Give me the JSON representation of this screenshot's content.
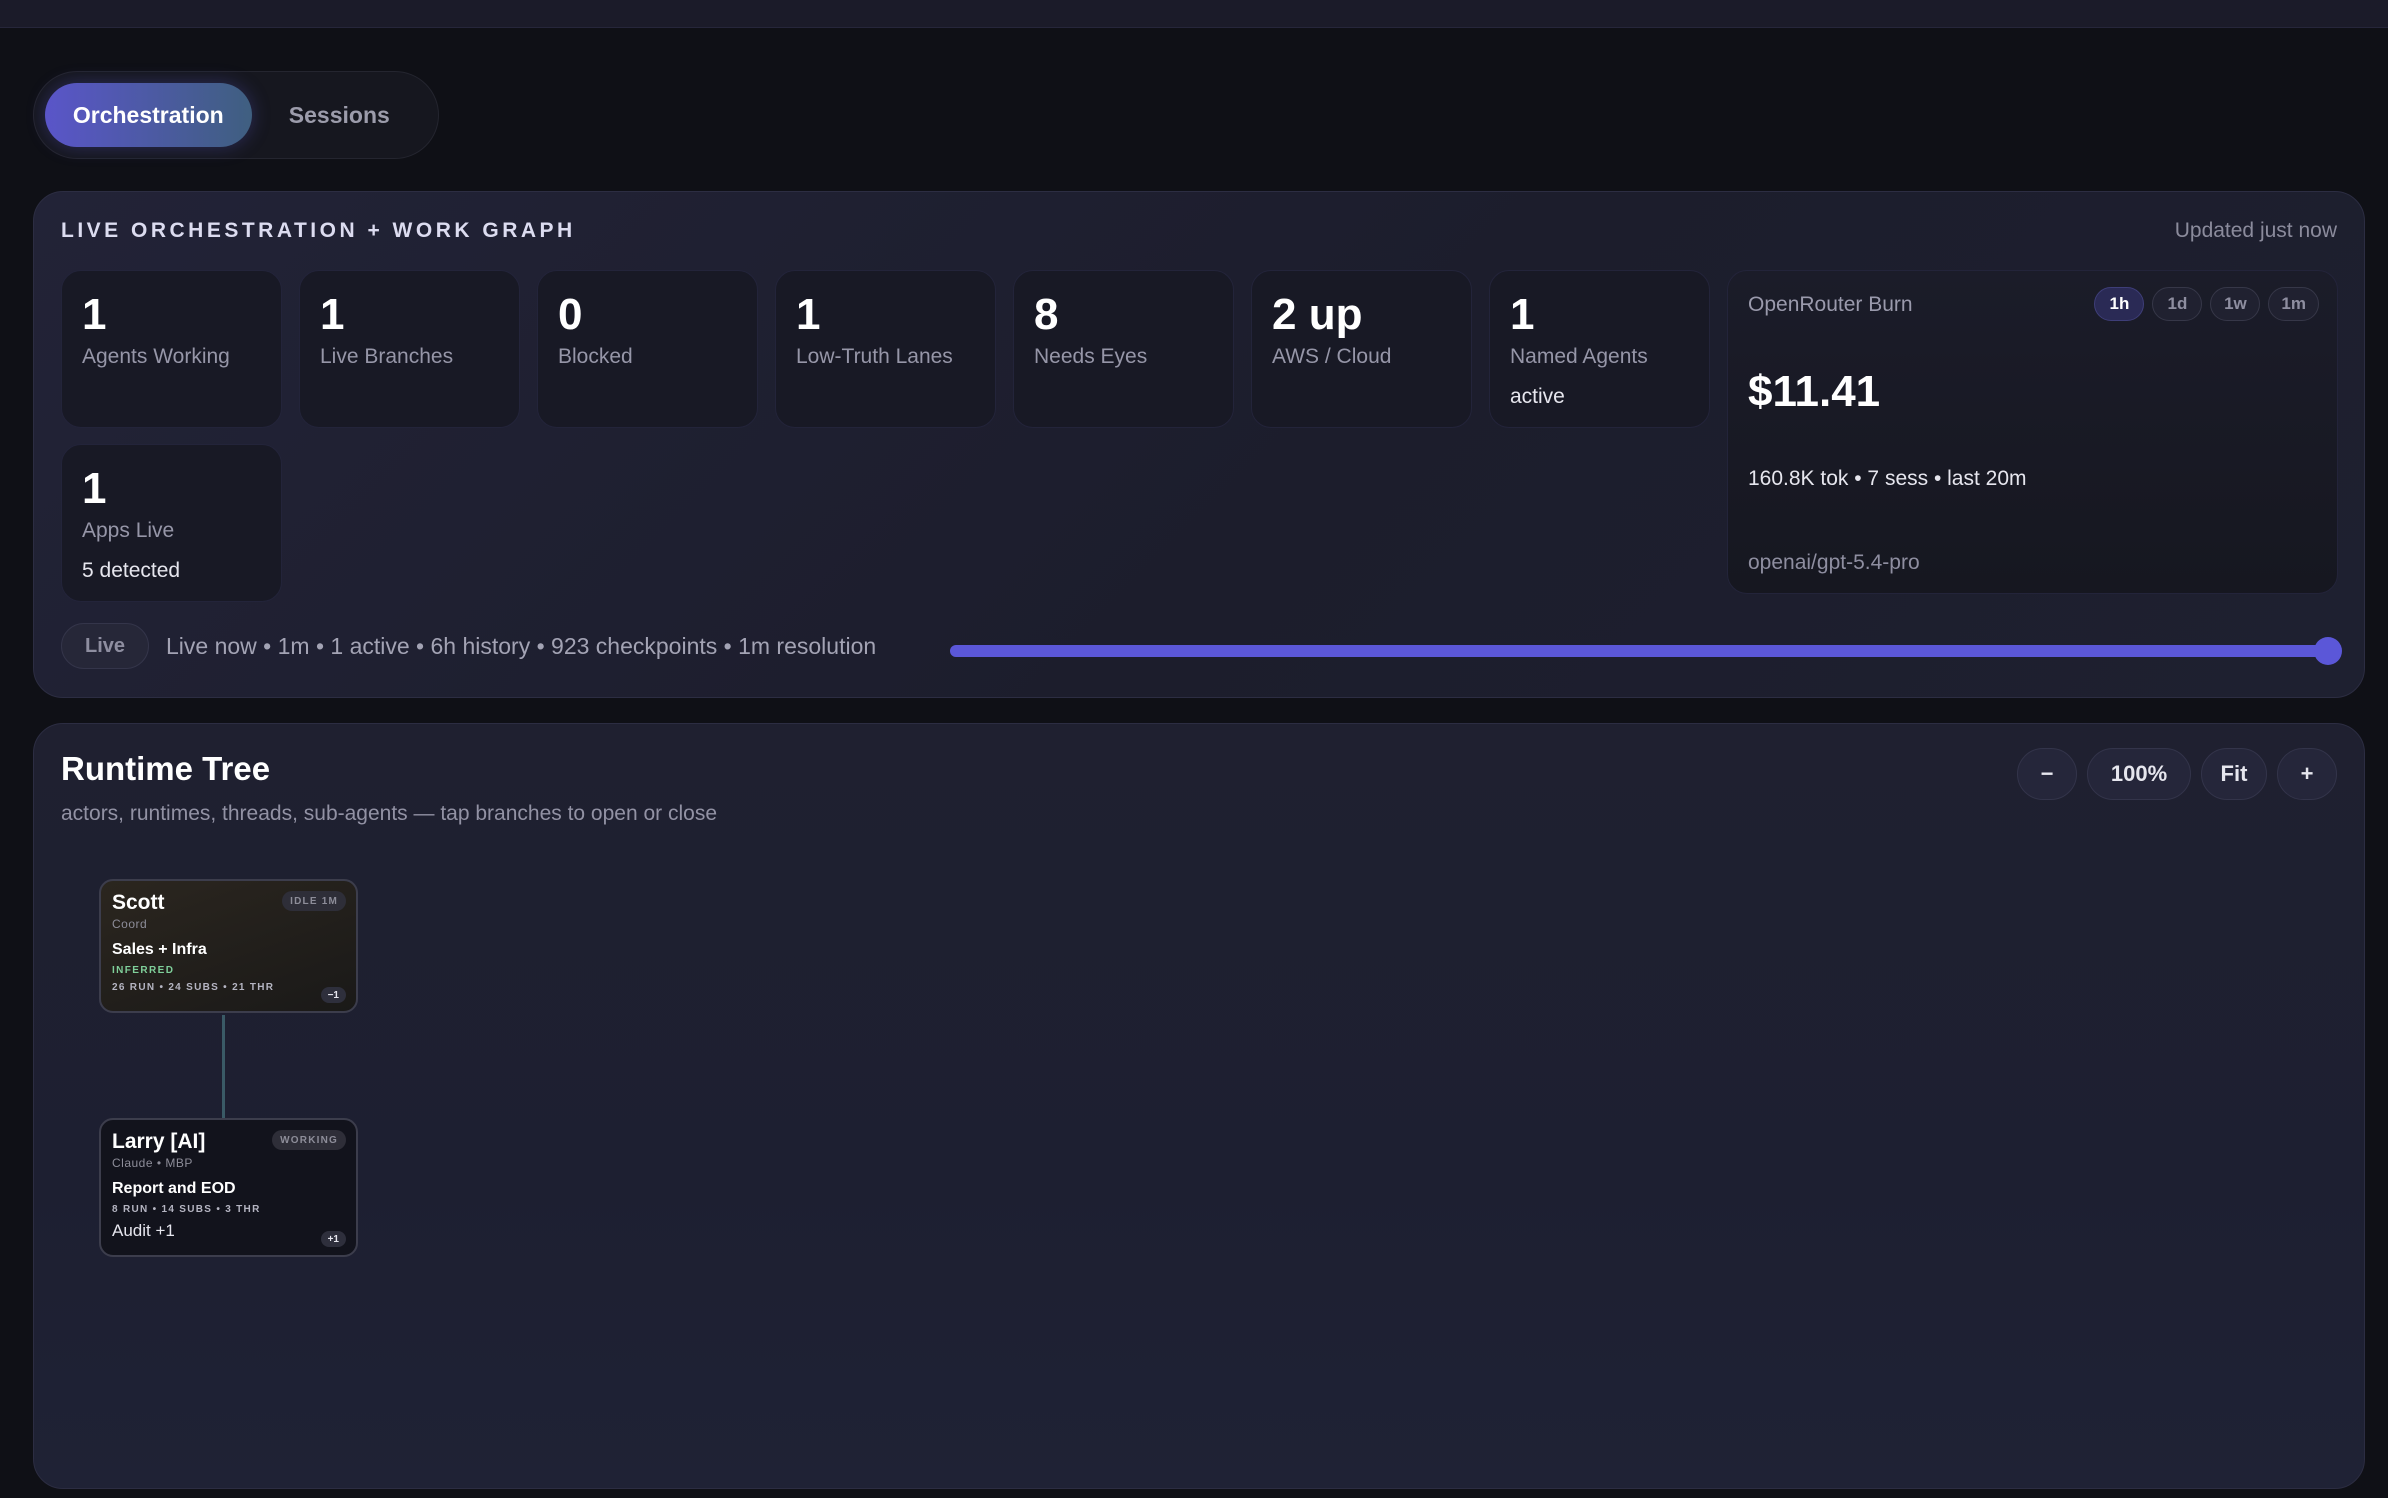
{
  "tabs": [
    {
      "label": "Orchestration",
      "active": true
    },
    {
      "label": "Sessions",
      "active": false
    }
  ],
  "overview": {
    "title": "LIVE ORCHESTRATION + WORK GRAPH",
    "updated": "Updated just now",
    "stats": [
      {
        "value": "1",
        "label": "Agents Working"
      },
      {
        "value": "1",
        "label": "Live Branches"
      },
      {
        "value": "0",
        "label": "Blocked"
      },
      {
        "value": "1",
        "label": "Low-Truth Lanes"
      },
      {
        "value": "8",
        "label": "Needs Eyes"
      },
      {
        "value": "2 up",
        "label": "AWS / Cloud"
      },
      {
        "value": "1",
        "label": "Named Agents",
        "sub": "active"
      },
      {
        "value": "1",
        "label": "Apps Live",
        "sub": "5 detected"
      }
    ],
    "burn": {
      "title": "OpenRouter Burn",
      "ranges": [
        "1h",
        "1d",
        "1w",
        "1m"
      ],
      "active_range": "1h",
      "amount": "$11.41",
      "meta": "160.8K tok • 7 sess • last 20m",
      "model": "openai/gpt-5.4-pro"
    },
    "live": {
      "pill": "Live",
      "info": "Live now • 1m • 1 active • 6h history • 923 checkpoints • 1m resolution",
      "position": 1.0
    }
  },
  "tree": {
    "title": "Runtime Tree",
    "subtitle": "actors, runtimes, threads, sub-agents — tap branches to open or close",
    "controls": {
      "minus": "−",
      "zoom": "100%",
      "fit": "Fit",
      "plus": "+"
    },
    "nodes": {
      "scott": {
        "name": "Scott",
        "badge": "IDLE 1M",
        "role": "Coord",
        "task": "Sales + Infra",
        "tag": "INFERRED",
        "stats": "26 RUN • 24 SUBS • 21 THR",
        "chip": "−1"
      },
      "larry": {
        "name": "Larry [AI]",
        "badge": "WORKING",
        "role": "Claude • MBP",
        "task": "Report and EOD",
        "stats": "8 RUN • 14 SUBS • 3 THR",
        "extra": "Audit +1",
        "chip": "+1"
      }
    }
  },
  "colors": {
    "accent": "#5b57d8",
    "background": "#0f1016",
    "panel": "#20213a",
    "inferred": "#7fcf9a"
  }
}
